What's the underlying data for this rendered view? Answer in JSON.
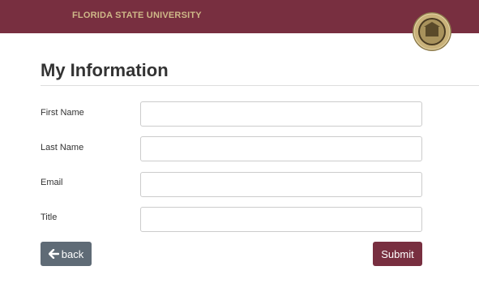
{
  "header": {
    "brand": "FLORIDA STATE UNIVERSITY",
    "logo_icon": "fsu-seal-icon",
    "background": "#782f40",
    "brand_color": "#ceb888"
  },
  "main": {
    "title": "My Information",
    "fields": [
      {
        "label": "First Name",
        "value": "",
        "placeholder": ""
      },
      {
        "label": "Last Name",
        "value": "",
        "placeholder": ""
      },
      {
        "label": "Email",
        "value": "",
        "placeholder": ""
      },
      {
        "label": "Title",
        "value": "",
        "placeholder": ""
      }
    ]
  },
  "actions": {
    "back_label": "back",
    "back_icon": "arrow-left-icon",
    "submit_label": "Submit",
    "back_color": "#5f6b76",
    "submit_color": "#782f40"
  }
}
